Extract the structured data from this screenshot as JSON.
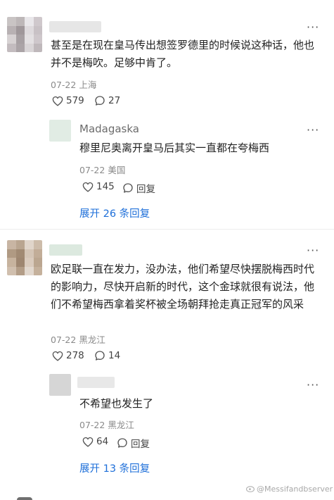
{
  "comments": [
    {
      "text": "甚至是在现在皇马传出想签罗德里的时候说这种话，他也并不是梅吹。足够中肯了。",
      "date": "07-22",
      "location": "上海",
      "likes": "579",
      "replies": "27",
      "reply": {
        "username": "Madagaska",
        "text": "穆里尼奥离开皇马后其实一直都在夸梅西",
        "date": "07-22",
        "location": "美国",
        "likes": "145",
        "reply_label": "回复"
      },
      "expand": "展开 26 条回复"
    },
    {
      "text": "欧足联一直在发力，没办法，他们希望尽快摆脱梅西时代的影响力，尽快开启新的时代，这个金球就很有说法，他们不希望梅西拿着奖杯被全场朝拜抢走真正冠军的风采",
      "date": "07-22",
      "location": "黑龙江",
      "likes": "278",
      "replies": "14",
      "reply": {
        "username": "",
        "text": "不希望也发生了",
        "date": "07-22",
        "location": "黑龙江",
        "likes": "64",
        "reply_label": "回复"
      },
      "expand": "展开 13 条回复"
    }
  ],
  "watermark": "@Messifandbserver",
  "more_glyph": "···"
}
